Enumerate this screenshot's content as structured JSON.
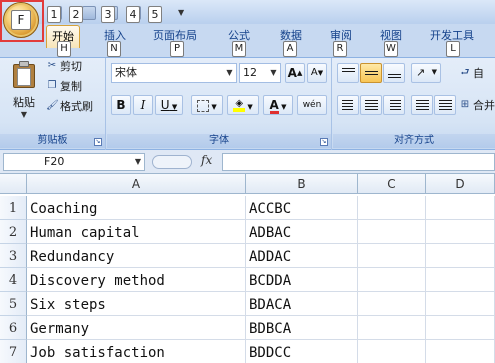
{
  "qat": {
    "office_key": "F",
    "keys": [
      "1",
      "2",
      "3",
      "4",
      "5"
    ]
  },
  "tabs": [
    {
      "label": "开始",
      "key": "H"
    },
    {
      "label": "插入",
      "key": "N"
    },
    {
      "label": "页面布局",
      "key": "P"
    },
    {
      "label": "公式",
      "key": "M"
    },
    {
      "label": "数据",
      "key": "A"
    },
    {
      "label": "审阅",
      "key": "R"
    },
    {
      "label": "视图",
      "key": "W"
    },
    {
      "label": "开发工具",
      "key": "L"
    }
  ],
  "clipboard": {
    "group_label": "剪贴板",
    "paste_label": "粘贴",
    "cut_label": "剪切",
    "copy_label": "复制",
    "format_painter_label": "格式刷"
  },
  "font": {
    "group_label": "字体",
    "font_name": "宋体",
    "font_size": "12",
    "bold": "B",
    "italic": "I",
    "underline": "U",
    "grow": "A",
    "shrink": "A",
    "font_color_label": "A",
    "phonetic_label": "wén",
    "fill_color": "#ffff00",
    "font_color": "#e03030"
  },
  "alignment": {
    "group_label": "对齐方式",
    "wrap_label": "自",
    "merge_label": "合并"
  },
  "formula_bar": {
    "name_box": "F20",
    "fx_label": "fx",
    "formula_value": ""
  },
  "columns": [
    "A",
    "B",
    "C",
    "D"
  ],
  "rows": [
    {
      "num": "1",
      "a": "Coaching",
      "b": "ACCBC"
    },
    {
      "num": "2",
      "a": "Human capital",
      "b": "ADBAC"
    },
    {
      "num": "3",
      "a": "Redundancy",
      "b": "ADDAC"
    },
    {
      "num": "4",
      "a": "Discovery method",
      "b": "BCDDA"
    },
    {
      "num": "5",
      "a": "Six steps",
      "b": "BDACA"
    },
    {
      "num": "6",
      "a": "Germany",
      "b": "BDBCA"
    },
    {
      "num": "7",
      "a": "Job satisfaction",
      "b": "BDDCC"
    }
  ]
}
